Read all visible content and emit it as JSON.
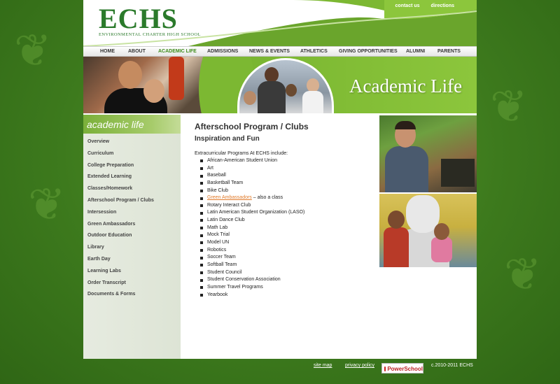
{
  "colors": {
    "accent": "#3d8b1a",
    "link_orange": "#e07a2a",
    "background_green": "#3f7a1e"
  },
  "header": {
    "logo_text": "ECHS",
    "logo_subtitle": "ENVIRONMENTAL CHARTER HIGH SCHOOL",
    "top_links": [
      "contact us",
      "directions"
    ]
  },
  "nav": {
    "items": [
      "HOME",
      "ABOUT",
      "ACADEMIC LIFE",
      "ADMISSIONS",
      "NEWS & EVENTS",
      "ATHLETICS",
      "GIVING OPPORTUNITIES",
      "ALUMNI",
      "PARENTS"
    ],
    "active": "ACADEMIC LIFE"
  },
  "banner": {
    "title": "Academic Life"
  },
  "sidebar": {
    "title": "academic life",
    "items": [
      "Overview",
      "Curriculum",
      "College Preparation",
      "Extended Learning",
      "Classes/Homework",
      "Afterschool Program / Clubs",
      "Intersession",
      "Green Ambassadors",
      "Outdoor Education",
      "Library",
      "Earth Day",
      "Learning Labs",
      "Order Transcript",
      "Documents & Forms"
    ]
  },
  "main": {
    "title": "Afterschool Program / Clubs",
    "subtitle": "Inspiration and Fun",
    "intro": "Extracurricular Programs At ECHS include:",
    "programs": [
      "African-American Student Union",
      "Art",
      "Baseball",
      "Basketball Team",
      "Bike Club",
      "Green Ambassadors",
      "Rotary Interact Club",
      "Latin American Student Organization (LASO)",
      "Latin Dance Club",
      "Math Lab",
      "Mock Trial",
      "Model UN",
      "Robotics",
      "Soccer Team",
      "Softball Team",
      "Student Council",
      "Student Conservation Association",
      "Summer Travel Programs",
      "Yearbook"
    ],
    "green_ambassadors_note": " – also a class"
  },
  "footer": {
    "links": [
      "site map",
      "privacy policy"
    ],
    "badge": "PowerSchool",
    "copyright": "c.2010-2011 ECHS"
  }
}
